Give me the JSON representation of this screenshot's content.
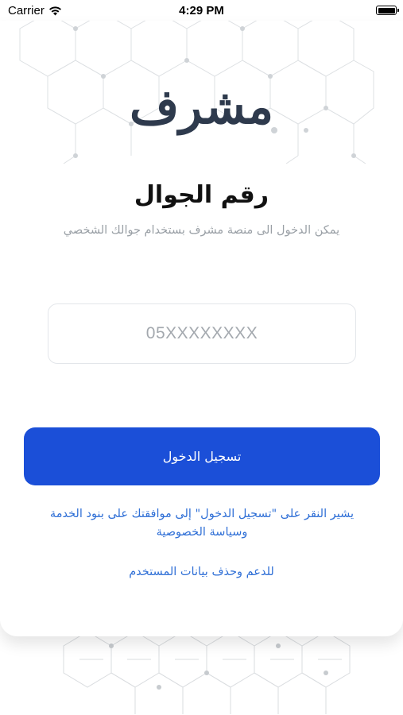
{
  "status_bar": {
    "carrier": "Carrier",
    "time": "4:29 PM"
  },
  "brand": {
    "logo_text": "مشرف"
  },
  "login": {
    "title": "رقم الجوال",
    "subtitle": "يمكن الدخول الى منصة مشرف بستخدام جوالك الشخصي",
    "phone_placeholder": "05XXXXXXXX",
    "phone_value": "",
    "login_button_label": "تسجيل الدخول",
    "terms_line_1": "يشير النقر على \"تسجيل الدخول\" إلى موافقتك على بنود الخدمة",
    "terms_line_2": "وسياسة الخصوصية",
    "support_link": "للدعم وحذف بيانات المستخدم"
  },
  "colors": {
    "primary": "#1b4fd8",
    "link": "#2f6fd6",
    "title": "#111111",
    "subtitle": "#9aa0a6",
    "logo": "#2e3a4d"
  },
  "icons": [
    "wifi-icon",
    "battery-icon"
  ]
}
